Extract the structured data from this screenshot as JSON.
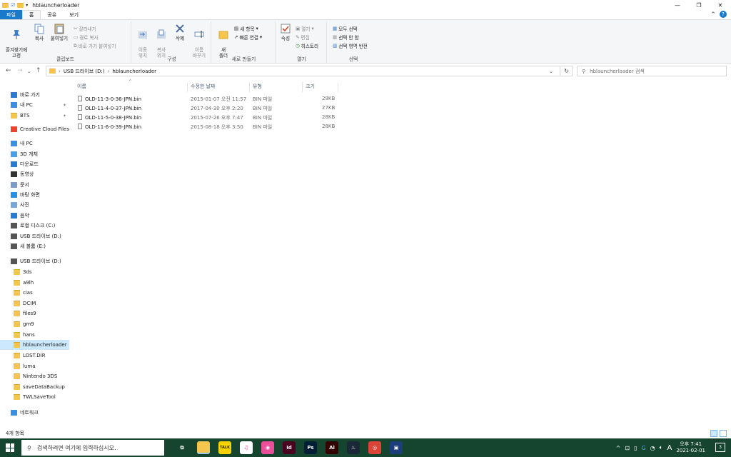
{
  "window": {
    "title": "hblauncherloader",
    "controls": {
      "minimize": "—",
      "maximize": "❐",
      "close": "✕"
    }
  },
  "ribbon_tabs": [
    "파일",
    "홈",
    "공유",
    "보기"
  ],
  "ribbon": {
    "clipboard": {
      "pin": "즐겨찾기에\n고정",
      "copy": "복사",
      "paste": "붙여넣기",
      "cut": "잘라내기",
      "copy_path": "경로 복사",
      "paste_shortcut": "바로 가기 붙여넣기",
      "label": "클립보드"
    },
    "organize": {
      "move": "이동\n위치",
      "copy_to": "복사\n위치",
      "delete": "삭제",
      "rename": "이름\n바꾸기",
      "label": "구성"
    },
    "new": {
      "new_folder": "새\n폴더",
      "new_item": "새 항목",
      "easy_access": "빠른 연결",
      "label": "새로 만들기"
    },
    "open": {
      "properties": "속성",
      "open": "열기",
      "edit": "편집",
      "history": "히스토리",
      "label": "열기"
    },
    "select": {
      "select_all": "모두 선택",
      "select_none": "선택 안 함",
      "invert": "선택 영역 반전",
      "label": "선택"
    }
  },
  "address": {
    "parts": [
      "USB 드라이브 (D:)",
      "hblauncherloader"
    ],
    "search_placeholder": "hblauncherloader 검색"
  },
  "nav_items": [
    {
      "label": "바로 가기",
      "icon": "star-icon",
      "top": 0
    },
    {
      "label": "내 PC",
      "icon": "pc-icon",
      "pin": true
    },
    {
      "label": "BTS",
      "icon": "folder-icon",
      "pin": true
    },
    {
      "label": "Creative Cloud Files",
      "icon": "cc-icon"
    },
    {
      "label": "내 PC",
      "icon": "pc-icon"
    },
    {
      "label": "3D 개체",
      "icon": "cube-icon"
    },
    {
      "label": "다운로드",
      "icon": "download-icon"
    },
    {
      "label": "동영상",
      "icon": "video-icon"
    },
    {
      "label": "문서",
      "icon": "document-icon"
    },
    {
      "label": "바탕 화면",
      "icon": "desktop-icon"
    },
    {
      "label": "사진",
      "icon": "picture-icon"
    },
    {
      "label": "음악",
      "icon": "music-icon"
    },
    {
      "label": "로컬 디스크 (C:)",
      "icon": "disk-icon"
    },
    {
      "label": "USB 드라이브 (D:)",
      "icon": "drive-icon"
    },
    {
      "label": "새 볼륨 (E:)",
      "icon": "drive-icon"
    },
    {
      "label": "USB 드라이브 (D:)",
      "icon": "drive-icon"
    },
    {
      "label": "3ds",
      "icon": "folder-icon"
    },
    {
      "label": "a9lh",
      "icon": "folder-icon"
    },
    {
      "label": "cias",
      "icon": "folder-icon"
    },
    {
      "label": "DCIM",
      "icon": "folder-icon"
    },
    {
      "label": "files9",
      "icon": "folder-icon"
    },
    {
      "label": "gm9",
      "icon": "folder-icon"
    },
    {
      "label": "hans",
      "icon": "folder-icon"
    },
    {
      "label": "hblauncherloader",
      "icon": "folder-icon",
      "selected": true
    },
    {
      "label": "LOST.DIR",
      "icon": "folder-icon"
    },
    {
      "label": "luma",
      "icon": "folder-icon"
    },
    {
      "label": "Nintendo 3DS",
      "icon": "folder-icon"
    },
    {
      "label": "saveDataBackup",
      "icon": "folder-icon"
    },
    {
      "label": "TWLSaveTool",
      "icon": "folder-icon"
    },
    {
      "label": "네트워크",
      "icon": "network-icon"
    }
  ],
  "columns": {
    "name": "이름",
    "modified": "수정한 날짜",
    "type": "유형",
    "size": "크기"
  },
  "files": [
    {
      "name": "OLD-11-3-0-36-JPN.bin",
      "modified": "2015-01-07 오전 11:57",
      "type": "BIN 파일",
      "size": "29KB"
    },
    {
      "name": "OLD-11-4-0-37-JPN.bin",
      "modified": "2017-04-30 오후 2:20",
      "type": "BIN 파일",
      "size": "27KB"
    },
    {
      "name": "OLD-11-5-0-38-JPN.bin",
      "modified": "2015-07-26 오후 7:47",
      "type": "BIN 파일",
      "size": "28KB"
    },
    {
      "name": "OLD-11-6-0-39-JPN.bin",
      "modified": "2015-08-18 오후 3:50",
      "type": "BIN 파일",
      "size": "28KB"
    }
  ],
  "status": {
    "item_count": "4개 항목"
  },
  "taskbar": {
    "search_placeholder": "검색하려면 여기에 입력하십시오.",
    "apps": [
      {
        "name": "task-view-icon",
        "label": "⧉",
        "color": "transparent"
      },
      {
        "name": "file-explorer-icon",
        "label": "",
        "color": "#f4c64d",
        "active": true
      },
      {
        "name": "kakaotalk-icon",
        "label": "TALK",
        "color": "#f7d100"
      },
      {
        "name": "itunes-icon",
        "label": "♫",
        "color": "#ffffff"
      },
      {
        "name": "photos-icon",
        "label": "◉",
        "color": "#e94f9b"
      },
      {
        "name": "indesign-icon",
        "label": "Id",
        "color": "#49021f"
      },
      {
        "name": "photoshop-icon",
        "label": "Ps",
        "color": "#001e36"
      },
      {
        "name": "illustrator-icon",
        "label": "Ai",
        "color": "#330000"
      },
      {
        "name": "steam-icon",
        "label": "♨",
        "color": "#1b2838"
      },
      {
        "name": "chrome-icon",
        "label": "◎",
        "color": "#db4437"
      },
      {
        "name": "game-icon",
        "label": "▣",
        "color": "#1c3f7c"
      }
    ],
    "tray_text": "A",
    "time": "오후 7:41",
    "date": "2021-02-01",
    "notifications": "3"
  }
}
